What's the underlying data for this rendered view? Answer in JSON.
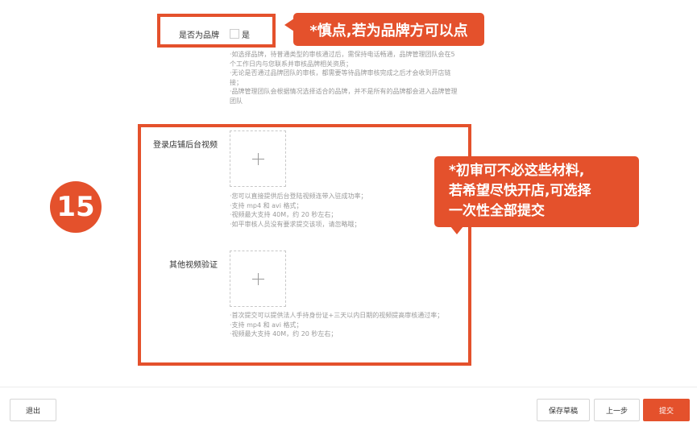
{
  "brand": {
    "label": "是否为品牌",
    "option": "是",
    "callout": "*慎点,若为品牌方可以点",
    "help": [
      "·如选择品牌，待普通类型的审核通过后，需保持电话畅通，品牌管理团队会在5",
      "个工作日内与您联系并审核品牌相关资质；",
      "·无论是否通过品牌团队的审核，都需要等待品牌审核完成之后才会收到开店链",
      "接；",
      "·品牌管理团队会根据情况选择适合的品牌，并不是所有的品牌都会进入品牌管理",
      "团队"
    ]
  },
  "step_badge": "15",
  "video": {
    "label": "登录店铺后台视频",
    "help": [
      "·您可以直接提供后台登陆视频连带入驻成功率；",
      "·支持 mp4 和 avi 格式；",
      "·视频最大支持 40M，约 20 秒左右；",
      "·如平审核人员没有要求提交该项，请忽略哦；"
    ]
  },
  "other_video": {
    "label": "其他视频验证",
    "help": [
      "·首次提交可以提供法人手持身份证+三天以内日期的视频提高审核通过率；",
      "·支持 mp4 和 avi 格式；",
      "·视频最大支持 40M，约 20 秒左右；"
    ]
  },
  "callout2": [
    "*初审可不必这些材料,",
    "若希望尽快开店,可选择",
    "一次性全部提交"
  ],
  "footer": {
    "exit": "退出",
    "save_draft": "保存草稿",
    "prev": "上一步",
    "submit": "提交"
  },
  "colors": {
    "accent": "#e4512c"
  }
}
